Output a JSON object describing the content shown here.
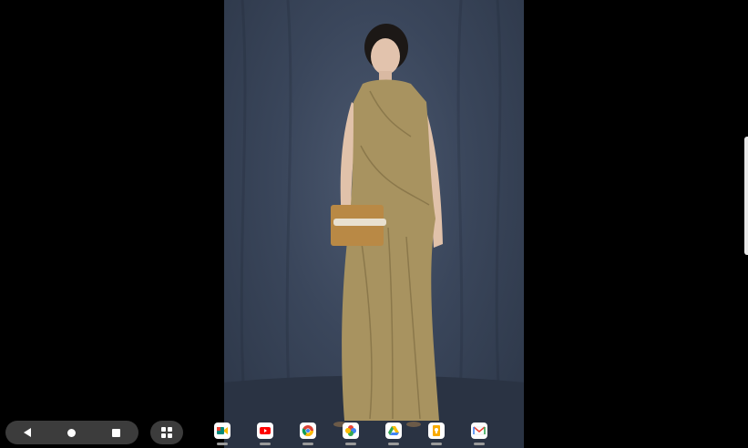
{
  "viewer": {
    "background": "#000000",
    "photo": {
      "description_icon": "image-icon",
      "backdrop_color": "#3a465b",
      "dress_color": "#a89360",
      "clutch_color": "#b98945"
    }
  },
  "navigation": {
    "back_icon": "back-triangle-icon",
    "home_icon": "home-circle-icon",
    "overview_icon": "overview-square-icon",
    "apps_icon": "app-grid-icon"
  },
  "shelf": {
    "apps": [
      {
        "icon": "google-meet-icon",
        "color": "#00897b"
      },
      {
        "icon": "youtube-icon",
        "color": "#ff0000"
      },
      {
        "icon": "chrome-icon",
        "color": "#4285f4"
      },
      {
        "icon": "photos-icon",
        "color": "#fbbc04"
      },
      {
        "icon": "drive-icon",
        "color": "#34a853"
      },
      {
        "icon": "keep-icon",
        "color": "#f9ab00"
      },
      {
        "icon": "gmail-icon",
        "color": "#ea4335"
      }
    ]
  }
}
